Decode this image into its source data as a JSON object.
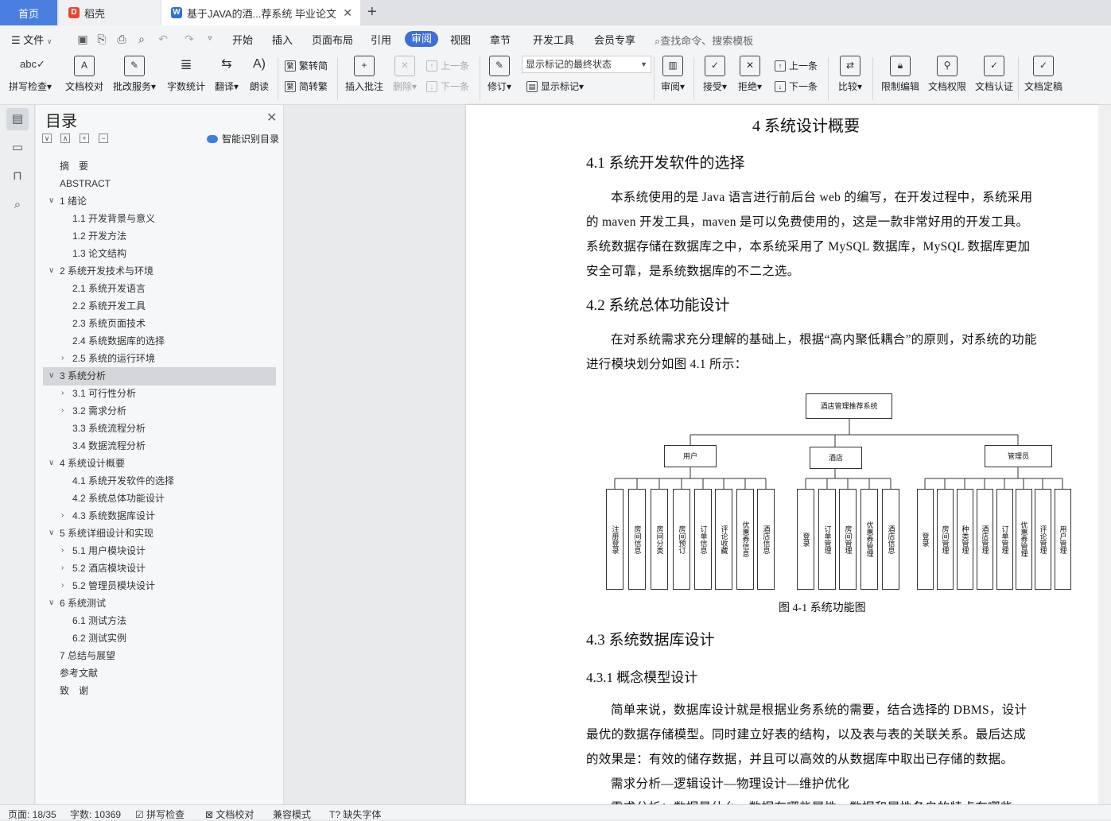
{
  "tabs": {
    "home": "首页",
    "daoke": "稻壳",
    "doc": "基于JAVA的酒...荐系统 毕业论文"
  },
  "menu": {
    "file": "文件",
    "items": [
      "开始",
      "插入",
      "页面布局",
      "引用",
      "审阅",
      "视图",
      "章节",
      "开发工具",
      "会员专享"
    ],
    "search": "查找命令、搜索模板"
  },
  "ribbon": {
    "spell": "拼写检查",
    "proof": "文档校对",
    "annotate": "批改服务",
    "wordcount": "字数统计",
    "translate": "翻译",
    "read": "朗读",
    "to_trad": "繁转简",
    "to_simp": "简转繁",
    "insert_comment": "插入批注",
    "delete": "删除",
    "prev": "上一条",
    "next": "下一条",
    "revise": "修订",
    "display_mode": "显示标记的最终状态",
    "show_marks": "显示标记",
    "review": "审阅",
    "accept": "接受",
    "reject": "拒绝",
    "prev2": "上一条",
    "next2": "下一条",
    "compare": "比较",
    "restrict": "限制编辑",
    "permission": "文档权限",
    "certify": "文档认证",
    "finalize": "文档定稿"
  },
  "toc": {
    "title": "目录",
    "smart": "智能识别目录",
    "items": [
      {
        "label": "摘　要"
      },
      {
        "label": "ABSTRACT"
      },
      {
        "label": "1 绪论"
      },
      {
        "label": "1.1 开发背景与意义"
      },
      {
        "label": "1.2 开发方法"
      },
      {
        "label": "1.3 论文结构"
      },
      {
        "label": "2 系统开发技术与环境"
      },
      {
        "label": "2.1  系统开发语言"
      },
      {
        "label": "2.2  系统开发工具"
      },
      {
        "label": "2.3  系统页面技术"
      },
      {
        "label": "2.4  系统数据库的选择"
      },
      {
        "label": "2.5  系统的运行环境"
      },
      {
        "label": "3  系统分析"
      },
      {
        "label": "3.1 可行性分析"
      },
      {
        "label": "3.2 需求分析"
      },
      {
        "label": "3.3 系统流程分析"
      },
      {
        "label": "3.4 数据流程分析"
      },
      {
        "label": "4  系统设计概要"
      },
      {
        "label": "4.1  系统开发软件的选择"
      },
      {
        "label": "4.2  系统总体功能设计"
      },
      {
        "label": "4.3  系统数据库设计"
      },
      {
        "label": "5  系统详细设计和实现"
      },
      {
        "label": "5.1  用户模块设计"
      },
      {
        "label": "5.2  酒店模块设计"
      },
      {
        "label": "5.2  管理员模块设计"
      },
      {
        "label": "6  系统测试"
      },
      {
        "label": "6.1  测试方法"
      },
      {
        "label": "6.2  测试实例"
      },
      {
        "label": "7  总结与展望"
      },
      {
        "label": "参考文献"
      },
      {
        "label": "致　谢"
      }
    ]
  },
  "doc": {
    "chapter": "4  系统设计概要",
    "s41": "4.1  系统开发软件的选择",
    "p1": [
      "本系统使用的是 Java 语言进行前后台 web 的编写，在开发过程中，系统采用",
      "的 maven 开发工具，maven 是可以免费使用的，这是一款非常好用的开发工具。",
      "系统数据存储在数据库之中，本系统采用了 MySQL 数据库，MySQL 数据库更加",
      "安全可靠，是系统数据库的不二之选。"
    ],
    "s42": "4.2  系统总体功能设计",
    "p2": [
      "在对系统需求充分理解的基础上，根据“高内聚低耦合”的原则，对系统的功能",
      "进行模块划分如图 4.1 所示："
    ],
    "diagram": {
      "root": "酒店管理推荐系统",
      "user": "用户",
      "hotel": "酒店",
      "admin": "管理员",
      "user_items": [
        "注册登录",
        "房间信息",
        "房间分类",
        "房间预订",
        "订单信息",
        "评论收藏",
        "优惠券信息",
        "酒店信息"
      ],
      "hotel_items": [
        "登录",
        "订单管理",
        "房间管理",
        "优惠券管理",
        "酒店信息"
      ],
      "admin_items": [
        "登录",
        "房间管理",
        "种类管理",
        "酒店管理",
        "订单管理",
        "优惠券管理",
        "评论管理",
        "用户管理"
      ]
    },
    "caption": "图 4-1 系统功能图",
    "s43": "4.3  系统数据库设计",
    "s431": "4.3.1  概念模型设计",
    "p3": [
      "简单来说，数据库设计就是根据业务系统的需要，结合选择的 DBMS，设计",
      "最优的数据存储模型。同时建立好表的结构，以及表与表的关联关系。最后达成",
      "的效果是：有效的储存数据，并且可以高效的从数据库中取出已存储的数据。",
      "需求分析—逻辑设计—物理设计—维护优化",
      "需求分析：数据是什么，数据有哪些属性，数据和属性各自的特点有哪些"
    ]
  },
  "status": {
    "page": "页面: 18/35",
    "words": "字数: 10369",
    "spell": "拼写检查",
    "proof": "文档校对",
    "compat": "兼容模式",
    "missing_font": "缺失字体"
  }
}
